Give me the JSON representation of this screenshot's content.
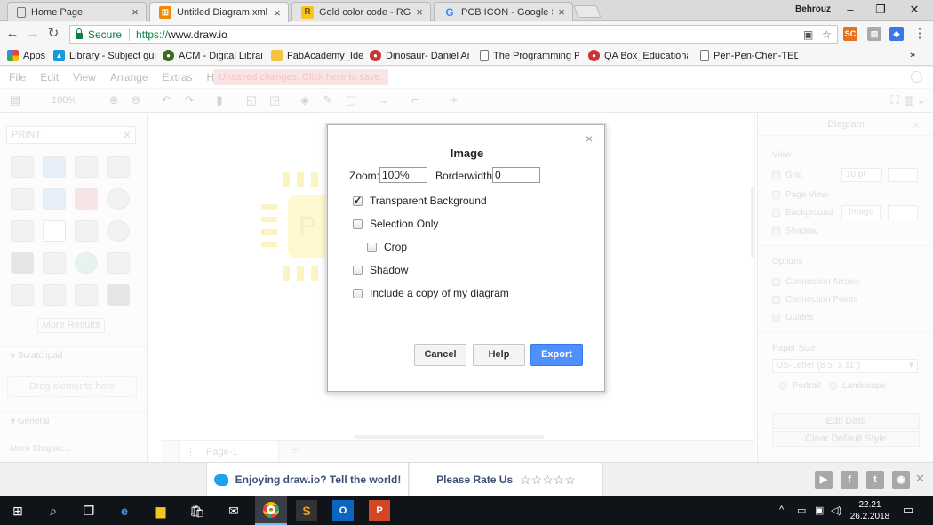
{
  "browser": {
    "tabs": [
      {
        "label": "Home Page",
        "favicon": "page-icon",
        "active": false
      },
      {
        "label": "Untitled Diagram.xml - d",
        "favicon": "drawio-icon",
        "active": true
      },
      {
        "label": "Gold color code - RGB g",
        "favicon": "r-icon",
        "active": false
      },
      {
        "label": "PCB ICON - Google Sear",
        "favicon": "google-icon",
        "active": false
      }
    ],
    "profile_name": "Behrouz",
    "secure_label": "Secure",
    "url_scheme": "https://",
    "url_host": "www.draw.io",
    "bookmarks": [
      {
        "label": "Apps"
      },
      {
        "label": "Library - Subject guid"
      },
      {
        "label": "ACM - Digital Library"
      },
      {
        "label": "FabAcademy_Ideas"
      },
      {
        "label": "Dinosaur- Daniel Am"
      },
      {
        "label": "The Programming Pu"
      },
      {
        "label": "QA Box_Educational"
      },
      {
        "label": "Pen-Pen-Chen-TED-E"
      }
    ],
    "bookmarks_more": "»"
  },
  "app": {
    "menu": [
      "File",
      "Edit",
      "View",
      "Arrange",
      "Extras",
      "Help"
    ],
    "unsaved_notice": "Unsaved changes. Click here to save.",
    "zoom": "100%",
    "sidebar": {
      "search_value": "PRINT",
      "more_results": "More Results",
      "scratchpad_title": "Scratchpad",
      "drag_hint": "Drag elements here",
      "general_title": "General",
      "more_shapes": "More Shapes..."
    },
    "canvas_text": "P",
    "page_tab": "Page-1",
    "format_panel": {
      "title": "Diagram",
      "view_header": "View",
      "grid_label": "Grid",
      "grid_size": "10 pt",
      "page_view_label": "Page View",
      "background_label": "Background",
      "image_button": "Image",
      "shadow_label": "Shadow",
      "options_header": "Options",
      "connection_arrows": "Connection Arrows",
      "connection_points": "Connection Points",
      "guides": "Guides",
      "paper_size_header": "Paper Size",
      "paper_size_value": "US-Letter (8,5\" x 11\")",
      "portrait": "Portrait",
      "landscape": "Landscape",
      "edit_data": "Edit Data",
      "clear_default_style": "Clear Default Style"
    }
  },
  "footer": {
    "promo_text": "Enjoying draw.io? Tell the world!",
    "rate_text": "Please Rate Us",
    "stars": "☆☆☆☆☆"
  },
  "dialog": {
    "title": "Image",
    "zoom_label": "Zoom:",
    "zoom_value": "100%",
    "borderwidth_label": "Borderwidth:",
    "borderwidth_value": "0",
    "options": [
      {
        "label": "Transparent Background",
        "checked": true
      },
      {
        "label": "Selection Only",
        "checked": false
      },
      {
        "label": "Crop",
        "checked": false
      },
      {
        "label": "Shadow",
        "checked": false
      },
      {
        "label": "Include a copy of my diagram",
        "checked": false
      }
    ],
    "cancel_label": "Cancel",
    "help_label": "Help",
    "export_label": "Export"
  },
  "taskbar": {
    "time": "22.21",
    "date": "26.2.2018"
  },
  "colors": {
    "export_button": "#4d90fe",
    "secure_green": "#0b8043",
    "twitter_blue": "#1da1f2",
    "taskbar": "#101318"
  }
}
